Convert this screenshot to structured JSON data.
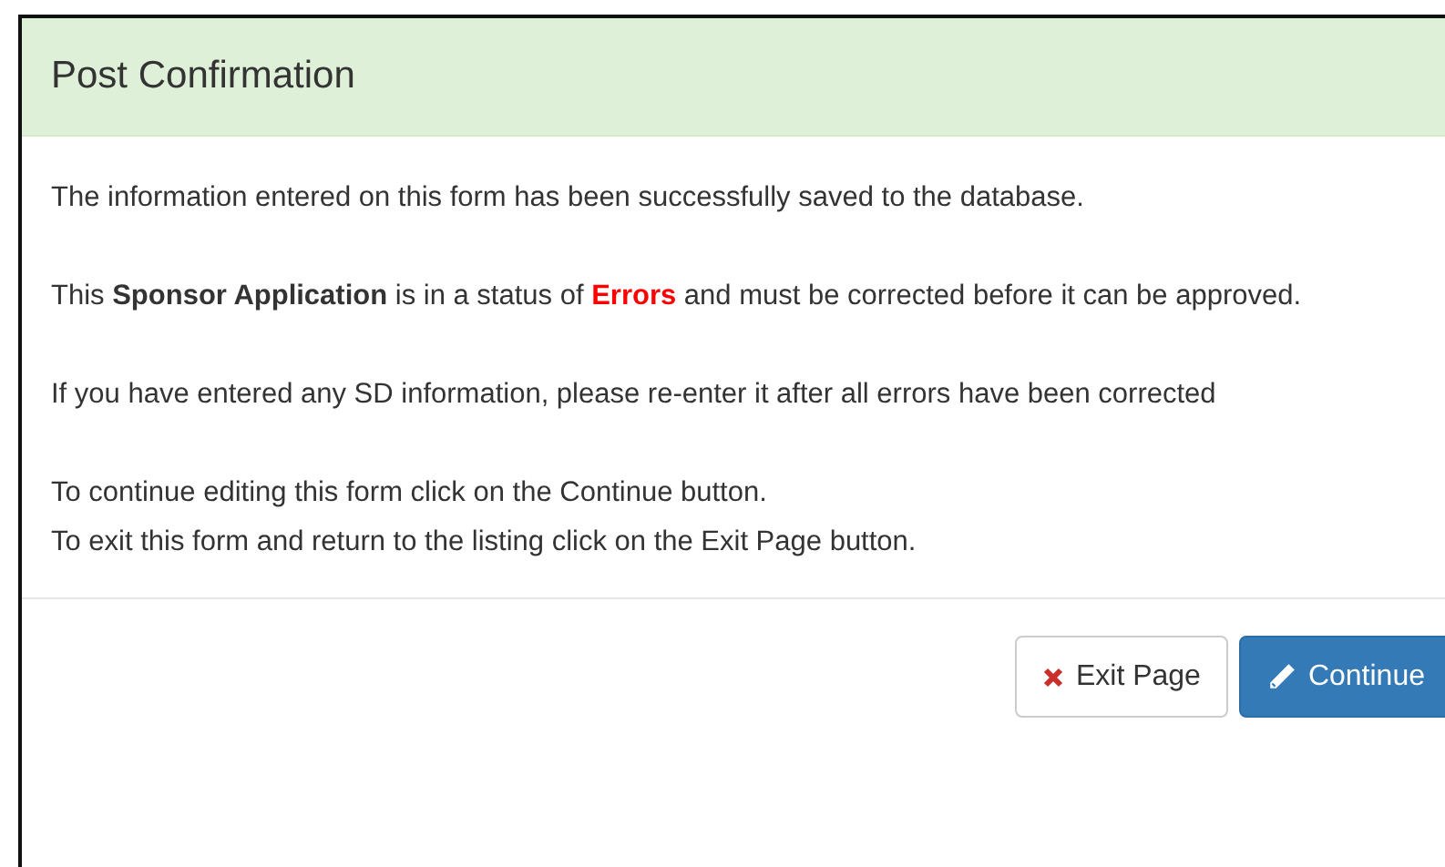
{
  "dialog": {
    "title": "Post Confirmation",
    "paragraphs": [
      {
        "lines": [
          [
            {
              "text": "The information entered on this form has been successfully saved to the database.",
              "kind": "plain"
            }
          ]
        ]
      },
      {
        "lines": [
          [
            {
              "text": "This ",
              "kind": "plain"
            },
            {
              "text": "Sponsor Application",
              "kind": "bold"
            },
            {
              "text": " is in a status of ",
              "kind": "plain"
            },
            {
              "text": "Errors",
              "kind": "alert"
            },
            {
              "text": " and must be corrected before it can be approved.",
              "kind": "plain"
            }
          ]
        ]
      },
      {
        "lines": [
          [
            {
              "text": "If you have entered any SD information, please re-enter it after all errors have been corrected",
              "kind": "plain"
            }
          ]
        ]
      },
      {
        "lines": [
          [
            {
              "text": "To continue editing this form click on the Continue button.",
              "kind": "plain"
            }
          ],
          [
            {
              "text": "To exit this form and return to the listing click on the Exit Page button.",
              "kind": "plain"
            }
          ]
        ]
      }
    ],
    "buttons": [
      {
        "label": "Exit Page",
        "kind": "exit"
      },
      {
        "label": "Continue",
        "kind": "continue"
      }
    ]
  }
}
